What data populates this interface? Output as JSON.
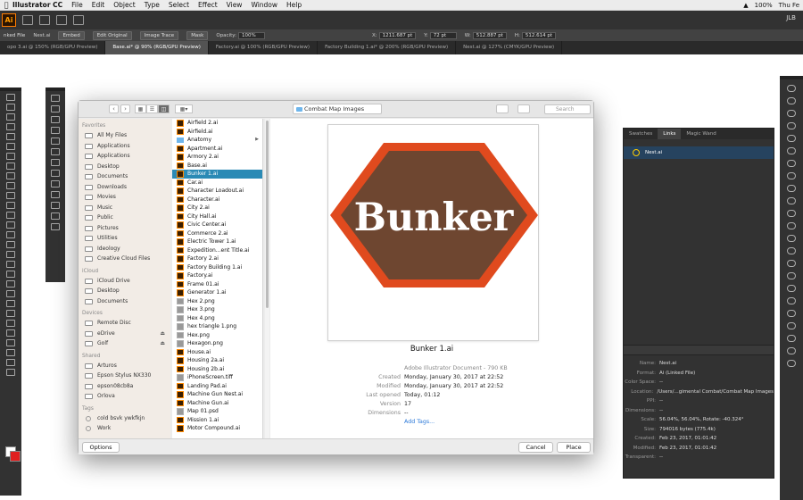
{
  "menubar": {
    "app": "Illustrator CC",
    "items": [
      "File",
      "Edit",
      "Object",
      "Type",
      "Select",
      "Effect",
      "View",
      "Window",
      "Help"
    ],
    "battery": "100%",
    "time": "Thu Fe"
  },
  "appbar": {
    "logo": "Ai",
    "user": "JLB"
  },
  "control_bar": {
    "file_label": "nked File",
    "file_name": "Nest.ai",
    "embed": "Embed",
    "edit_original": "Edit Original",
    "image_trace": "Image Trace",
    "mask": "Mask",
    "opacity_label": "Opacity:",
    "opacity": "100%",
    "x_label": "X:",
    "x": "1211.687 pt",
    "y_label": "Y:",
    "y": "72 pt",
    "w_label": "W:",
    "w": "512.887 pt",
    "h_label": "H:",
    "h": "512.614 pt"
  },
  "tabs": [
    "opo 3.ai @ 150% (RGB/GPU Preview)",
    "Base.ai* @ 90% (RGB/GPU Preview)",
    "Factory.ai @ 100% (RGB/GPU Preview)",
    "Factory Building 1.ai* @ 200% (RGB/GPU Preview)",
    "Nest.ai @ 127% (CMYK/GPU Preview)"
  ],
  "dialog": {
    "location": "Combat Map Images",
    "search_placeholder": "Search",
    "sidebar": [
      {
        "header": "Favorites",
        "items": [
          "All My Files",
          "Applications",
          "Applications",
          "Desktop",
          "Documents",
          "Downloads",
          "Movies",
          "Music",
          "Public",
          "Pictures",
          "Utilities",
          "Ideology",
          "Creative Cloud Files"
        ]
      },
      {
        "header": "iCloud",
        "items": [
          "iCloud Drive",
          "Desktop",
          "Documents"
        ]
      },
      {
        "header": "Devices",
        "items": [
          "Remote Disc",
          "eDrive",
          "Golf"
        ]
      },
      {
        "header": "Shared",
        "items": [
          "Arturos",
          "Epson Stylus NX330",
          "epson08cb8a",
          "Orlova"
        ]
      },
      {
        "header": "Tags",
        "items": [
          "cold bsvk ywkfkjn",
          "Work"
        ]
      }
    ],
    "files": [
      "Airfield 2.ai",
      "Airfield.ai",
      "Anatomy",
      "Apartment.ai",
      "Armory 2.ai",
      "Base.ai",
      "Bunker 1.ai",
      "Car.ai",
      "Character Loadout.ai",
      "Character.ai",
      "City 2.ai",
      "City Hall.ai",
      "Civic Center.ai",
      "Commerce 2.ai",
      "Electric Tower 1.ai",
      "Expedition...ent Title.ai",
      "Factory 2.ai",
      "Factory Building 1.ai",
      "Factory.ai",
      "Frame 01.ai",
      "Generator 1.ai",
      "Hex 2.png",
      "Hex 3.png",
      "Hex 4.png",
      "hex triangle 1.png",
      "Hex.png",
      "Hexagon.png",
      "House.ai",
      "Housing 2a.ai",
      "Housing 2b.ai",
      "iPhoneScreen.tiff",
      "Landing Pad.ai",
      "Machine Gun Nest.ai",
      "Machine Gun.ai",
      "Map 01.psd",
      "Mission 1.ai",
      "Motor Compound.ai"
    ],
    "preview": {
      "graphic_text": "Bunker",
      "name": "Bunker 1.ai",
      "kind": "Adobe Illustrator Document - 790 KB",
      "rows": [
        {
          "k": "Created",
          "v": "Monday, January 30, 2017 at 22:52"
        },
        {
          "k": "Modified",
          "v": "Monday, January 30, 2017 at 22:52"
        },
        {
          "k": "Last opened",
          "v": "Today, 01:12"
        },
        {
          "k": "Version",
          "v": "17"
        },
        {
          "k": "Dimensions",
          "v": "--"
        }
      ],
      "add_tags": "Add Tags..."
    },
    "options": "Options",
    "cancel": "Cancel",
    "place": "Place"
  },
  "links_panel": {
    "tabs": [
      "Swatches",
      "Links",
      "Magic Wand"
    ],
    "link": "Nest.ai",
    "info": [
      {
        "k": "Name:",
        "v": "Nest.ai"
      },
      {
        "k": "Format:",
        "v": "Ai (Linked File)"
      },
      {
        "k": "Color Space:",
        "v": "--"
      },
      {
        "k": "Location:",
        "v": "/Users/...gimental Combat/Combat Map Images"
      },
      {
        "k": "PPI:",
        "v": "--"
      },
      {
        "k": "Dimensions:",
        "v": "--"
      },
      {
        "k": "Scale:",
        "v": "56.04%, 56.04%, Rotate: -40.324°"
      },
      {
        "k": "Size:",
        "v": "794016 bytes (775.4k)"
      },
      {
        "k": "Created:",
        "v": "Feb 23, 2017, 01:01:42"
      },
      {
        "k": "Modified:",
        "v": "Feb 23, 2017, 01:01:42"
      },
      {
        "k": "Transparent:",
        "v": "--"
      }
    ]
  },
  "colors": {
    "accent": "#2a8ab5",
    "hex_outer": "#e04a1e",
    "hex_inner": "#6e4630",
    "hex_text": "#ffffff"
  }
}
